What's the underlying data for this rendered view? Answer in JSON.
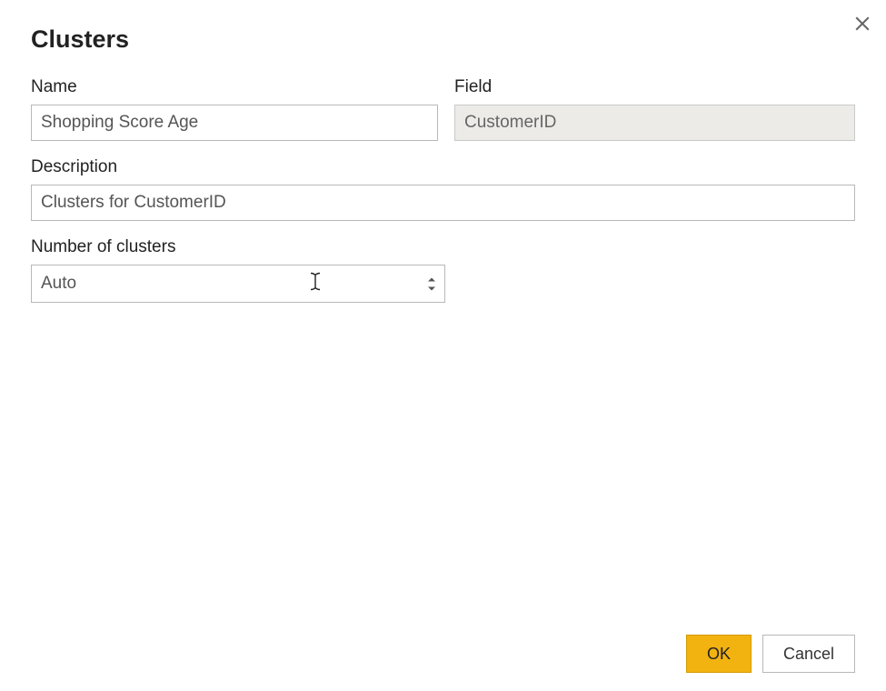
{
  "dialog": {
    "title": "Clusters",
    "fields": {
      "name": {
        "label": "Name",
        "value": "Shopping Score Age"
      },
      "field": {
        "label": "Field",
        "value": "CustomerID"
      },
      "description": {
        "label": "Description",
        "value": "Clusters for CustomerID"
      },
      "num_clusters": {
        "label": "Number of clusters",
        "value": "Auto"
      }
    },
    "buttons": {
      "ok": "OK",
      "cancel": "Cancel"
    }
  }
}
